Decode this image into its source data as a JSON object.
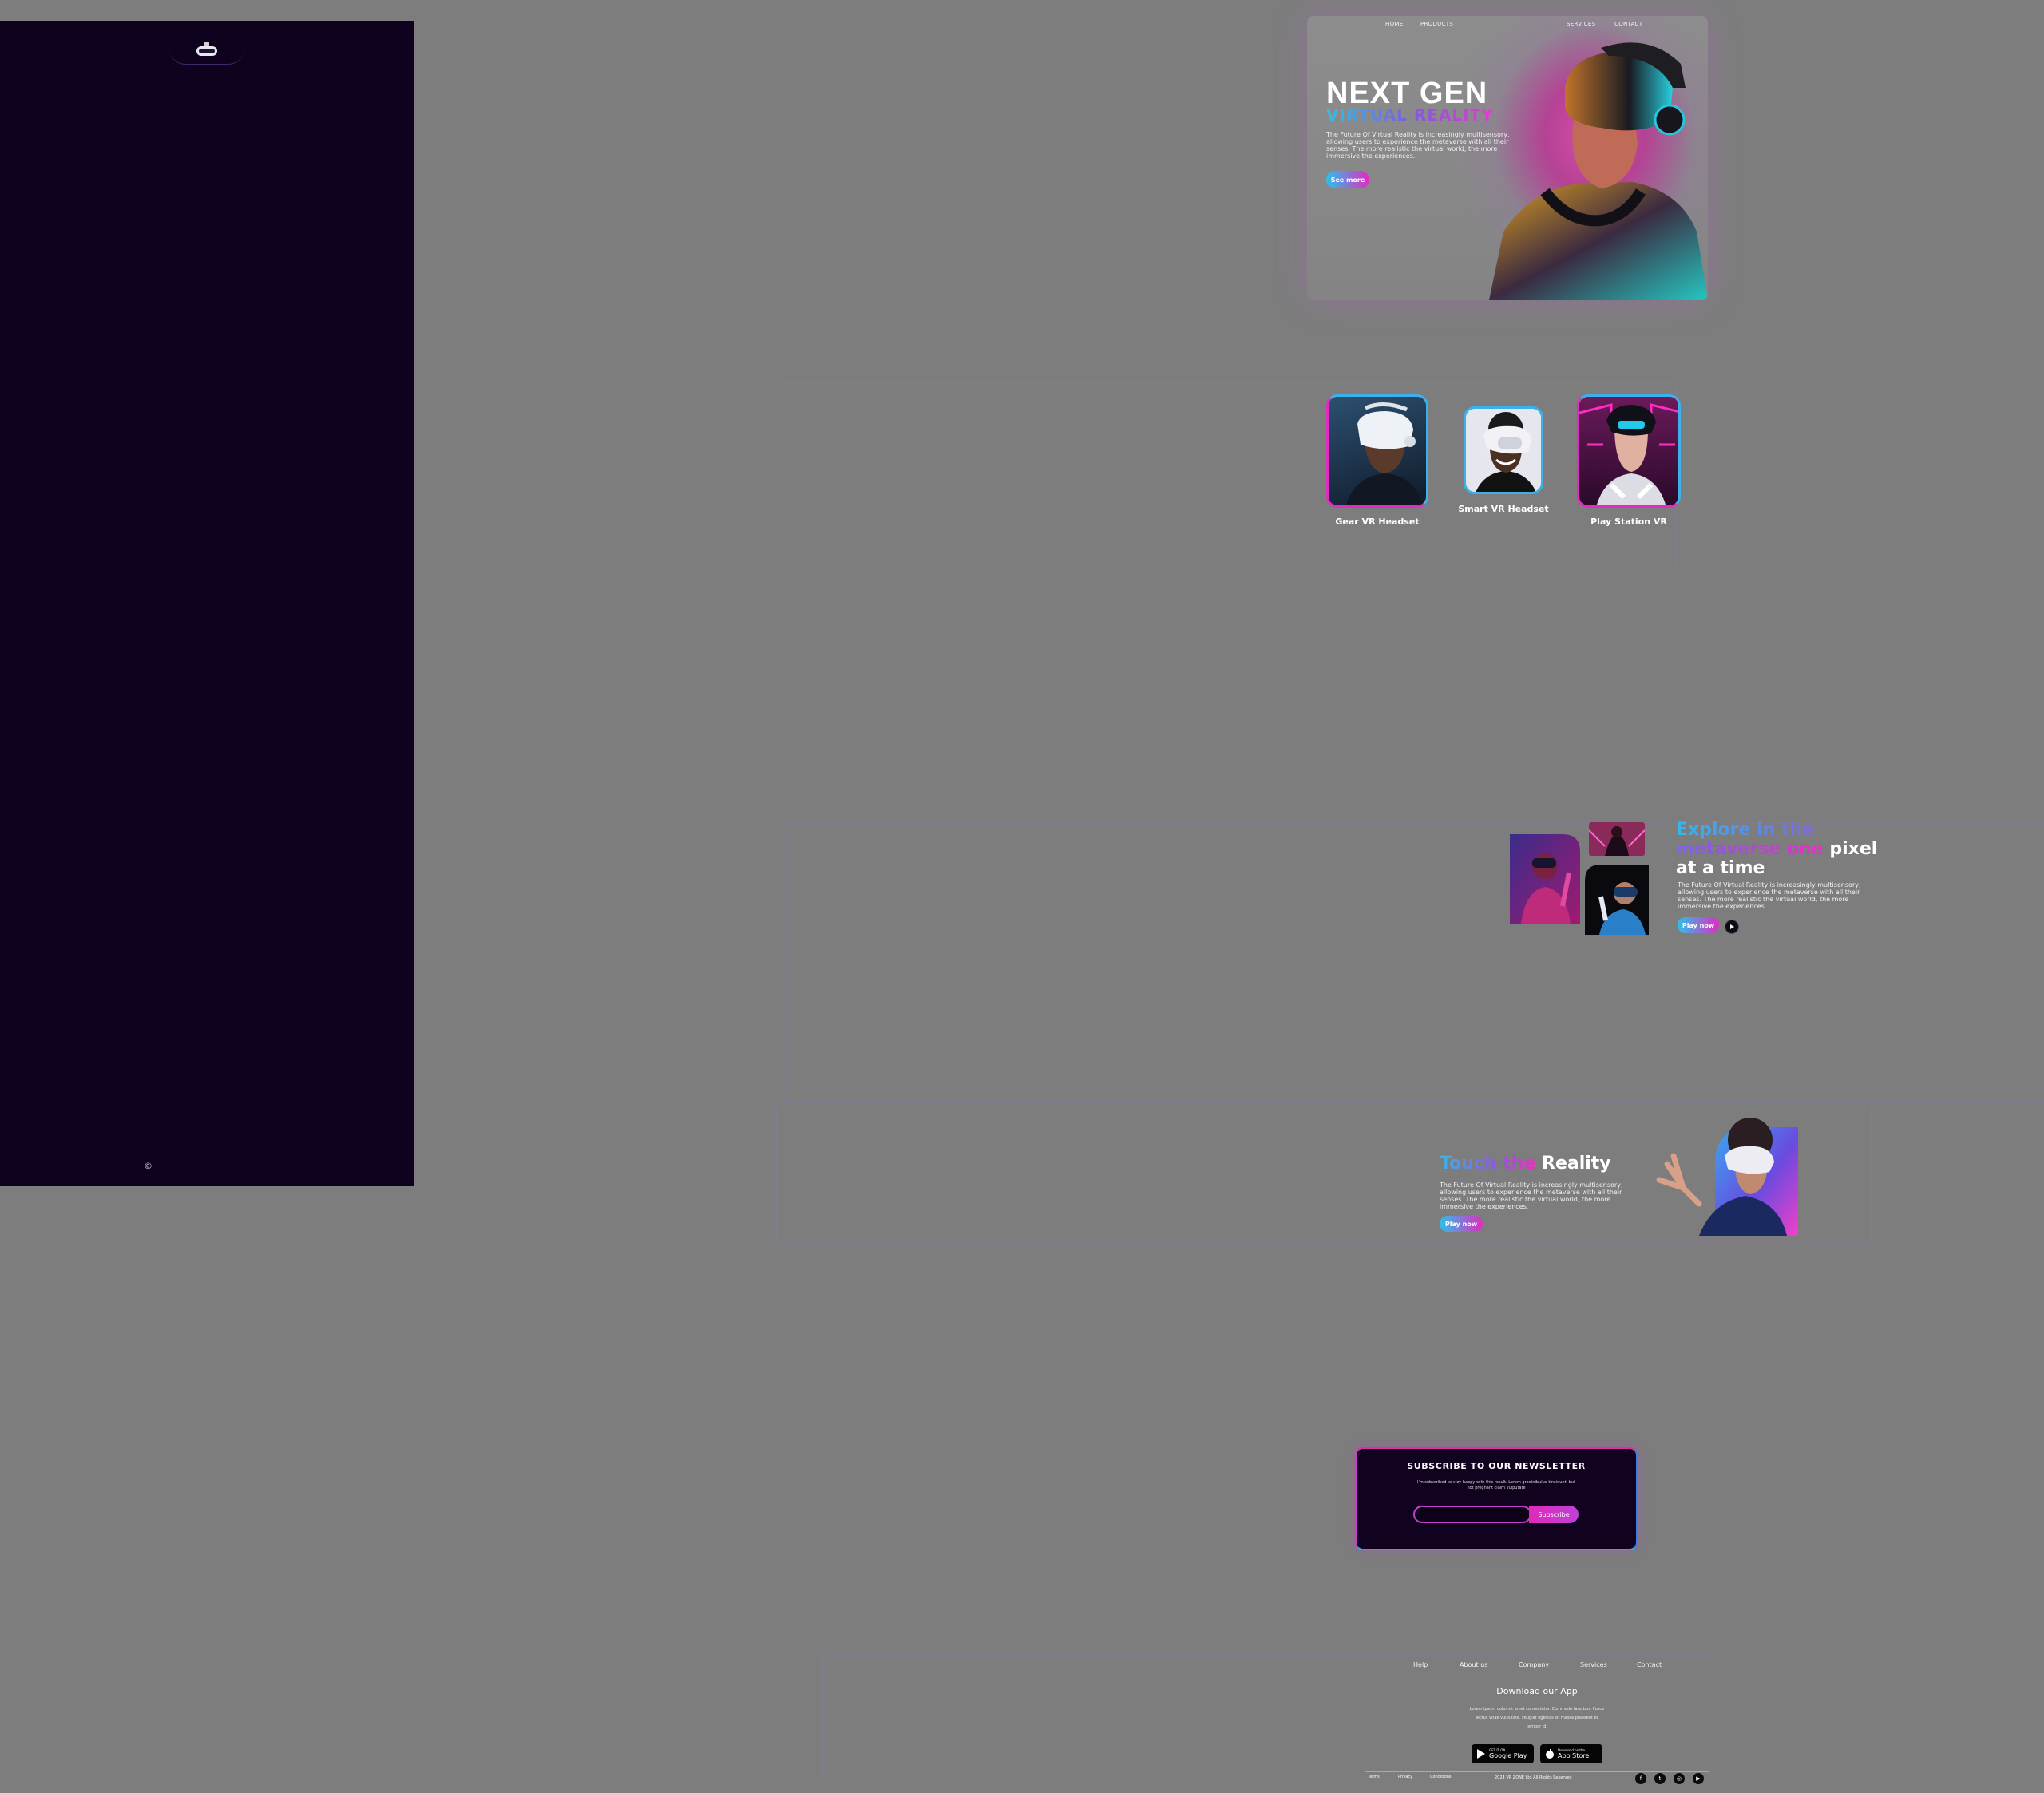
{
  "sidebar": {
    "copyright": "©",
    "logo_icon": "vr-headset-icon"
  },
  "hero": {
    "nav": [
      "HOME",
      "PRODUCTS",
      "SERVICES",
      "CONTACT"
    ],
    "title": "NEXT GEN",
    "subtitle": "VIRTUAL REALITY",
    "body": "The Future Of Virtual Reality is increasingly multisensory, allowing users to experience the metaverse with all their senses. The more realistic the virtual world, the more immersive the experiences.",
    "cta": "See more"
  },
  "products": {
    "items": [
      {
        "label": "Gear VR Headset"
      },
      {
        "label": "Smart VR Headset"
      },
      {
        "label": "Play Station VR"
      }
    ]
  },
  "explore": {
    "heading_grad": "Explore in the metaverse one",
    "heading_plain1": "pixel",
    "heading_plain2": "at a time",
    "body": "The Future Of Virtual Reality is increasingly multisensory, allowing users to experience the metaverse with all their senses. The more realistic the virtual world, the more immersive the experiences.",
    "cta": "Play now"
  },
  "touch": {
    "heading_grad": "Touch the",
    "heading_plain": "Reality",
    "body": "The Future Of Virtual Reality is increasingly multisensory, allowing users to experience the metaverse with all their senses. The more realistic the virtual world, the more immersive the experiences.",
    "cta": "Play now"
  },
  "newsletter": {
    "title": "SUBSCRIBE TO OUR NEWSLETTER",
    "body": "I'm subscribed to vrzy happy with this result. Lorem gradinibulue tincidunt, but not pregnant claim vulputate",
    "input_placeholder": "",
    "button": "Subscribe"
  },
  "footer": {
    "links": [
      "Help",
      "About us",
      "Company",
      "Services",
      "Contact"
    ],
    "download_title": "Download our App",
    "download_body": "Lorem ipsum dolor sit amet consectetur. Commodo faucibus. Fusce lectus vitae vulputate. Feugiat egestas sit massa praesent et tempor id.",
    "google_small": "GET IT ON",
    "google_big": "Google Play",
    "apple_small": "Download on the",
    "apple_big": "App Store",
    "legal": [
      "Terms",
      "Privacy",
      "Conditions"
    ],
    "copyright": "2024 VR ZONE Ltd All Rights Reserved",
    "social_icons": [
      "facebook-icon",
      "twitter-icon",
      "instagram-icon",
      "youtube-icon"
    ]
  },
  "colors": {
    "accent_cyan": "#2bc1ea",
    "accent_magenta": "#e22bc2",
    "panel": "#0f021e"
  }
}
